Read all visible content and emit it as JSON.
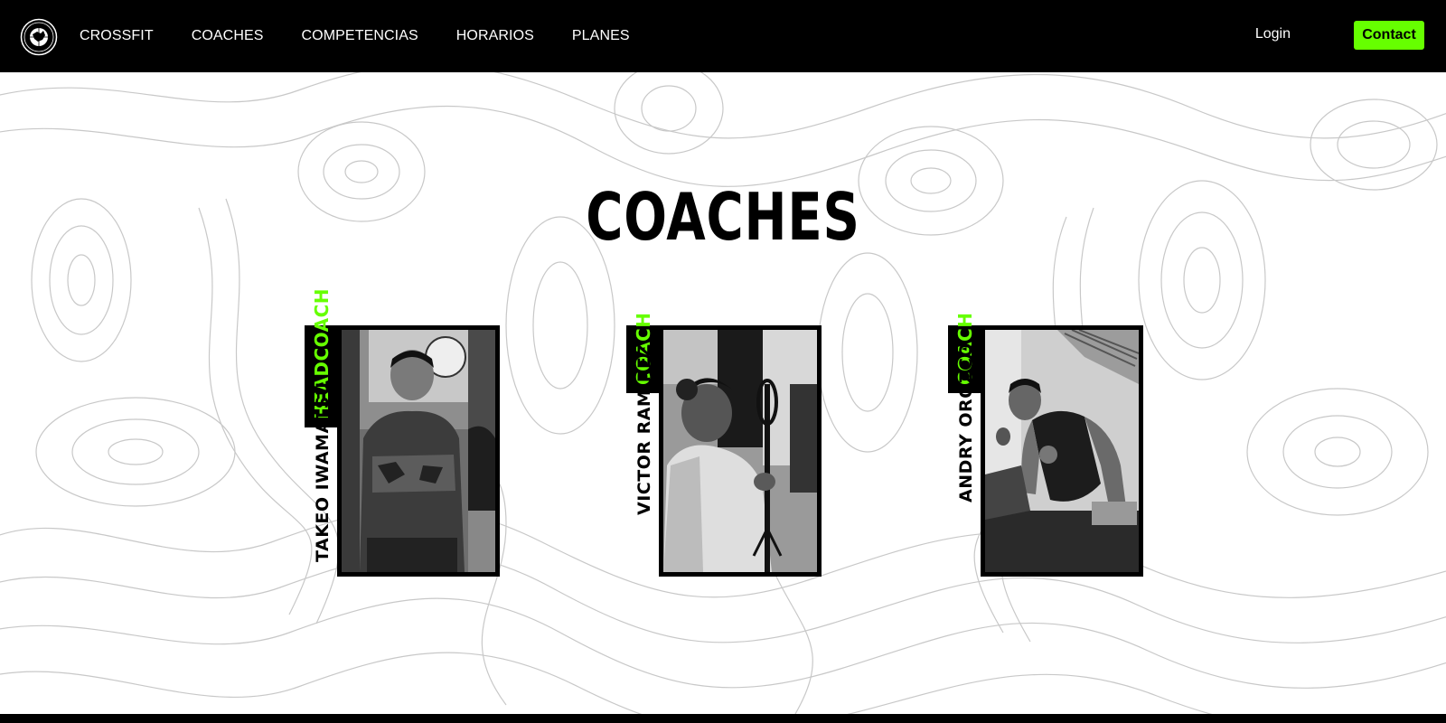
{
  "nav": {
    "links": [
      "CROSSFIT",
      "COACHES",
      "COMPETENCIAS",
      "HORARIOS",
      "PLANES"
    ],
    "login_label": "Login",
    "contact_label": "Contact"
  },
  "colors": {
    "accent": "#66ff00",
    "background": "#000000",
    "topo_line": "#c8c8c8"
  },
  "page": {
    "title": "COACHES"
  },
  "coaches": [
    {
      "name": "TAKEO IWAMATSU",
      "role": "HEADCOACH"
    },
    {
      "name": "VICTOR RAMIREZ",
      "role": "COACH"
    },
    {
      "name": "ANDRY OROZCO",
      "role": "COACH"
    }
  ]
}
